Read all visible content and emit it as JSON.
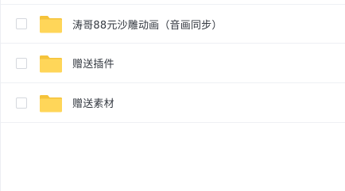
{
  "files": [
    {
      "name": "涛哥88元沙雕动画（音画同步）",
      "icon": "folder-icon"
    },
    {
      "name": "赠送插件",
      "icon": "folder-icon"
    },
    {
      "name": "赠送素材",
      "icon": "folder-icon"
    }
  ],
  "colors": {
    "folder_body": "#ffd659",
    "folder_tab": "#f5c33b",
    "text": "#333840",
    "divider": "#eef0f4"
  }
}
